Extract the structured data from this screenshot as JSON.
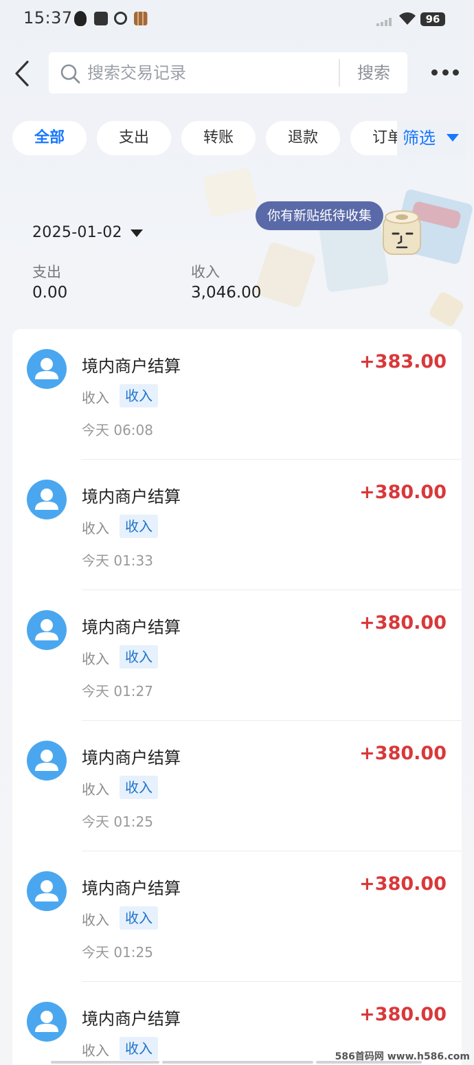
{
  "status_bar": {
    "time": "15:37",
    "battery": "96",
    "icons": [
      "qq-icon",
      "mail-icon",
      "leaf-icon",
      "grid-app-icon",
      "signal-icon",
      "wifi-icon",
      "battery-icon"
    ]
  },
  "header": {
    "search_placeholder": "搜索交易记录",
    "search_button": "搜索"
  },
  "tabs": [
    {
      "label": "全部",
      "active": true
    },
    {
      "label": "支出",
      "active": false
    },
    {
      "label": "转账",
      "active": false
    },
    {
      "label": "退款",
      "active": false
    },
    {
      "label": "订单",
      "active": false
    }
  ],
  "filter_label": "筛选",
  "sticker_text": "你有新贴纸待收集",
  "summary": {
    "date": "2025-01-02",
    "expense_label": "支出",
    "expense_value": "0.00",
    "income_label": "收入",
    "income_value": "3,046.00"
  },
  "transactions": [
    {
      "title": "境内商户结算",
      "amount": "+383.00",
      "type": "收入",
      "badge": "收入",
      "time": "今天 06:08"
    },
    {
      "title": "境内商户结算",
      "amount": "+380.00",
      "type": "收入",
      "badge": "收入",
      "time": "今天 01:33"
    },
    {
      "title": "境内商户结算",
      "amount": "+380.00",
      "type": "收入",
      "badge": "收入",
      "time": "今天 01:27"
    },
    {
      "title": "境内商户结算",
      "amount": "+380.00",
      "type": "收入",
      "badge": "收入",
      "time": "今天 01:25"
    },
    {
      "title": "境内商户结算",
      "amount": "+380.00",
      "type": "收入",
      "badge": "收入",
      "time": "今天 01:25"
    },
    {
      "title": "境内商户结算",
      "amount": "+380.00",
      "type": "收入",
      "badge": "收入",
      "time": ""
    }
  ],
  "watermark": "586首码网 www.h586.com",
  "colors": {
    "accent": "#1677ff",
    "amount": "#d9383a",
    "avatar": "#4aa7ef",
    "badge_bg": "#e6f1fd",
    "sticker_bubble": "#5a6aa8"
  }
}
